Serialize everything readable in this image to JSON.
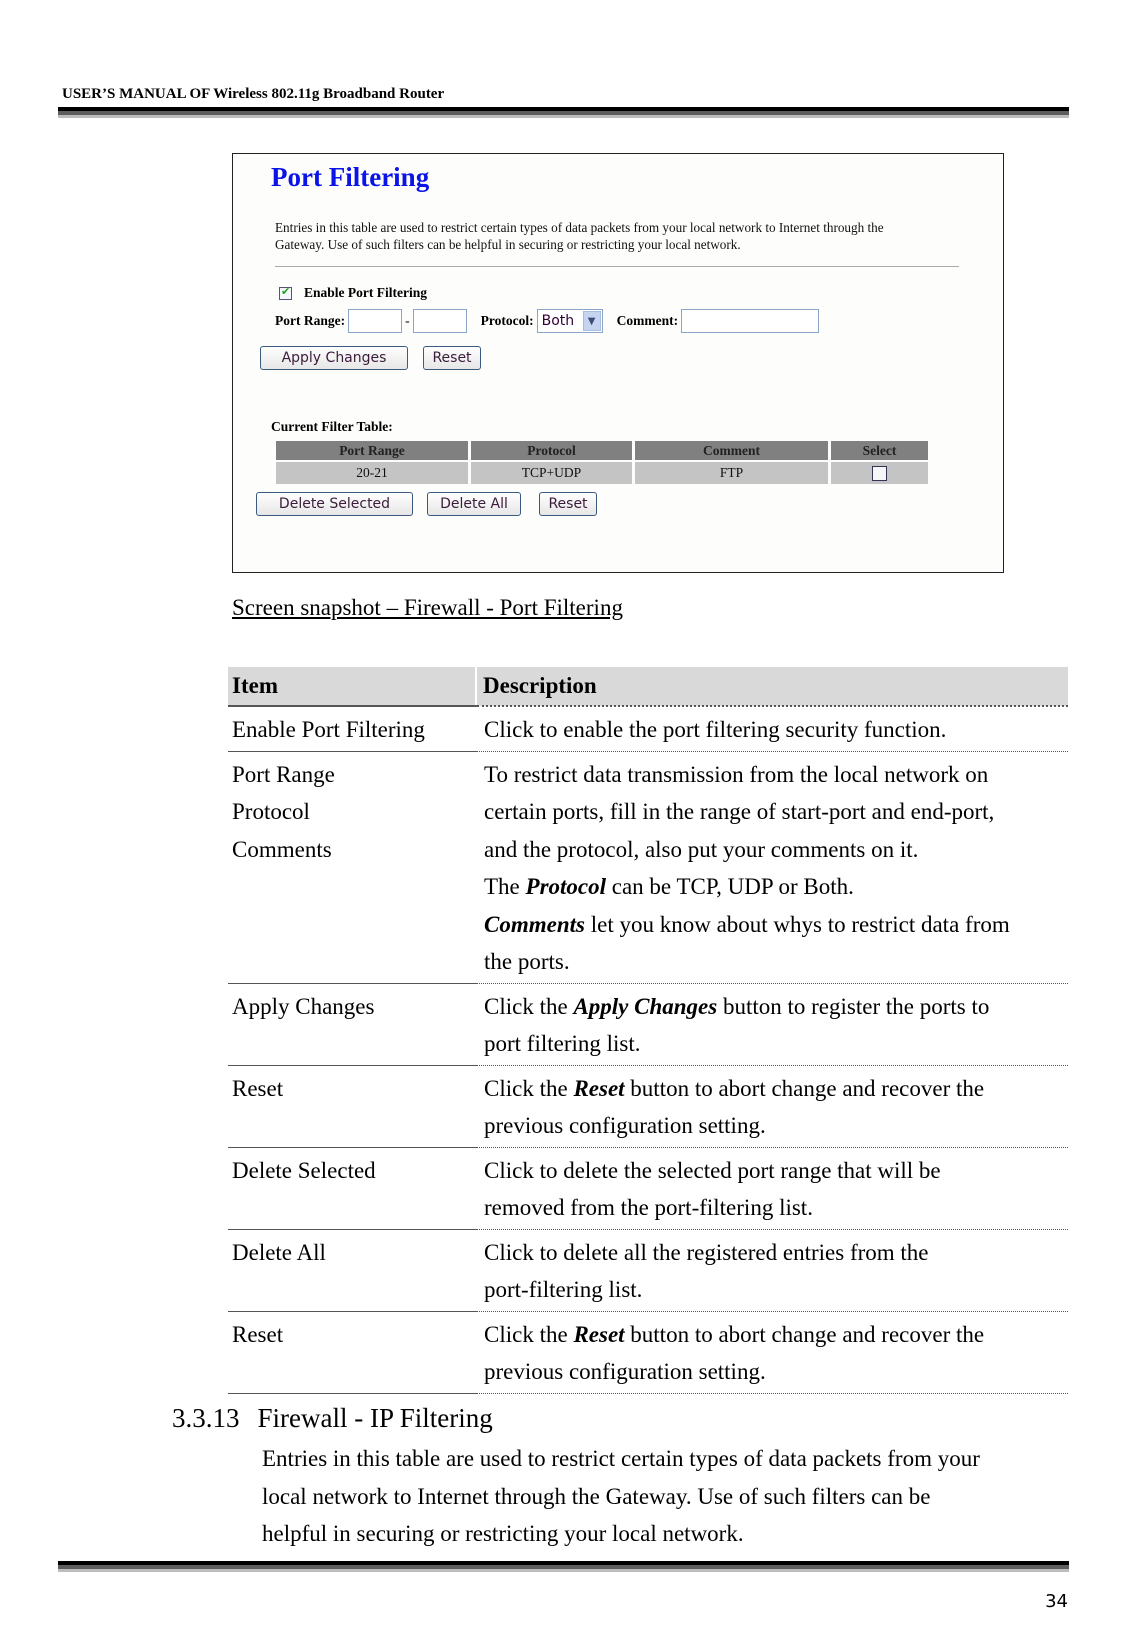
{
  "header": {
    "title": "USER’S MANUAL OF Wireless 802.11g Broadband Router"
  },
  "screenshot": {
    "title": "Port Filtering",
    "intro": "Entries in this table are used to restrict certain types of data packets from your local network to Internet through the Gateway. Use of such filters can be helpful in securing or restricting your local network.",
    "enable_checkbox": {
      "label": "Enable Port Filtering",
      "checked": true
    },
    "port_range_label": "Port Range:",
    "port_start_value": "",
    "port_separator": "-",
    "port_end_value": "",
    "protocol_label": "Protocol:",
    "protocol_selected": "Both",
    "comment_label": "Comment:",
    "comment_value": "",
    "apply_button": "Apply Changes",
    "reset_button": "Reset",
    "table_title": "Current Filter Table:",
    "table_headers": [
      "Port Range",
      "Protocol",
      "Comment",
      "Select"
    ],
    "table_rows": [
      {
        "port_range": "20-21",
        "protocol": "TCP+UDP",
        "comment": "FTP",
        "selected": false
      }
    ],
    "delete_selected_button": "Delete Selected",
    "delete_all_button": "Delete All",
    "reset_button_2": "Reset",
    "colors": {
      "title": "#0a14e6",
      "header_bg": "#808080",
      "row_bg": "#c4c4c4"
    }
  },
  "caption": "Screen snapshot – Firewall - Port Filtering",
  "desc_table": {
    "headers": [
      "Item",
      "Description"
    ],
    "rows": [
      {
        "items": [
          "Enable Port Filtering"
        ],
        "desc": [
          "Click to enable the port filtering security function."
        ]
      },
      {
        "items": [
          "Port Range",
          "Protocol",
          "Comments"
        ],
        "desc": [
          "To restrict data transmission from the local network on",
          "certain ports, fill in the range of start-port and end-port,",
          "and the protocol, also put your comments on it."
        ],
        "desc_protocol": {
          "pre": "The ",
          "em": "Protocol",
          "post": " can be TCP, UDP or Both."
        },
        "desc_comments": {
          "em": "Comments",
          "post": " let you know about whys to restrict data from",
          "line2": "the ports."
        }
      },
      {
        "items": [
          "Apply Changes"
        ],
        "pre": "Click the ",
        "em": "Apply Changes",
        "post": " button to register the ports to",
        "line2": "port filtering list."
      },
      {
        "items": [
          "Reset"
        ],
        "pre": "Click the ",
        "em": "Reset",
        "post": " button to abort change and recover the",
        "line2": "previous configuration setting."
      },
      {
        "items": [
          "Delete Selected"
        ],
        "desc": [
          "Click to delete the selected port range that will be",
          "removed from the port-filtering list."
        ]
      },
      {
        "items": [
          "Delete All"
        ],
        "desc": [
          "Click to delete all the registered entries from the",
          "port-filtering list."
        ]
      },
      {
        "items": [
          "Reset"
        ],
        "pre": "Click the ",
        "em": "Reset",
        "post": " button to abort change and recover the",
        "line2": "previous configuration setting."
      }
    ]
  },
  "section": {
    "number": "3.3.13",
    "title": "Firewall - IP Filtering",
    "body": [
      "Entries in this table are used to restrict certain types of data packets from your",
      "local network to Internet through the Gateway. Use of such filters can be",
      "helpful in securing or restricting your local network."
    ]
  },
  "footer": {
    "page_number": "34"
  }
}
